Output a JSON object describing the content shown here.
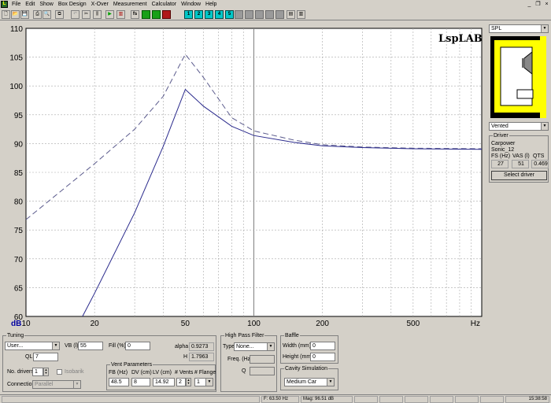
{
  "menu": [
    "File",
    "Edit",
    "Show",
    "Box Design",
    "X-Over",
    "Measurement",
    "Calculator",
    "Window",
    "Help"
  ],
  "window_controls": [
    "_",
    "æ",
    "×"
  ],
  "toolbar": {
    "num_buttons": [
      "1",
      "2",
      "3",
      "4",
      "5"
    ],
    "fs_label": "fs"
  },
  "logo": "LspLAB",
  "chart_data": {
    "type": "line",
    "x_scale": "log",
    "xlim": [
      10,
      1000
    ],
    "ylim": [
      60,
      110
    ],
    "ylabel": "dB",
    "xlabel": "Hz",
    "x_ticks": [
      "10",
      "20",
      "50",
      "100",
      "200",
      "500"
    ],
    "y_ticks": [
      "110",
      "105",
      "100",
      "95",
      "90",
      "85",
      "80",
      "75",
      "70",
      "65",
      "60"
    ],
    "grid": true,
    "series": [
      {
        "style": "dashed",
        "color": "#5a5a8c",
        "x": [
          10,
          20,
          30,
          40,
          50,
          60,
          80,
          100,
          150,
          200,
          300,
          500,
          1000
        ],
        "y": [
          76.8,
          86.5,
          92.5,
          98.2,
          105.5,
          101.5,
          94.5,
          92.2,
          90.6,
          89.8,
          89.4,
          89.2,
          89.1
        ]
      },
      {
        "style": "solid",
        "color": "#2a2a8c",
        "x": [
          17.7,
          20,
          30,
          40,
          50,
          60,
          80,
          100,
          150,
          200,
          300,
          500,
          1000
        ],
        "y": [
          60,
          64,
          78,
          89.5,
          99.4,
          96.5,
          93,
          91.4,
          90.2,
          89.6,
          89.3,
          89.1,
          89.0
        ]
      }
    ]
  },
  "right_panel": {
    "view_select": "SPL",
    "box_type_select": "Vented",
    "driver_group_title": "Driver",
    "driver_brand": "Carpower",
    "driver_model": "Sonic_12",
    "params_headers": [
      "FS (Hz)",
      "VAS (l)",
      "QTS"
    ],
    "params_values": [
      "27",
      "51",
      "0.469"
    ],
    "select_driver_button": "Select driver"
  },
  "tuning": {
    "title": "Tuning",
    "mode_select": "User...",
    "vb_label": "VB (l)",
    "vb_value": "55",
    "fill_label": "Fill (%)",
    "fill_value": "0",
    "ql_label": "QL",
    "ql_value": "7",
    "alpha_label": "alpha",
    "alpha_value": "0.9273",
    "h_label": "H",
    "h_value": "1.7963",
    "no_drivers_label": "No. drivers",
    "no_drivers_value": "1",
    "isobarik_label": "Isobarik",
    "connection_label": "Connection",
    "connection_value": "Parallel"
  },
  "vent": {
    "title": "Vent Parameters",
    "headers": [
      "FB (Hz)",
      "DV (cm)",
      "LV (cm)",
      "# Vents",
      "# Flange"
    ],
    "values": [
      "48.5",
      "8",
      "14.92",
      "2",
      "1"
    ]
  },
  "high_pass": {
    "title": "High Pass Filter",
    "type_label": "Type",
    "type_value": "None...",
    "freq_label": "Freq. (Hz)",
    "q_label": "Q"
  },
  "baffle": {
    "title": "Baffle",
    "width_label": "Width (mm)",
    "width_value": "0",
    "height_label": "Height (mm)",
    "height_value": "0"
  },
  "cavity": {
    "title": "Cavity Simulation",
    "value": "Medium Car"
  },
  "status": {
    "freq": "F: 63.50 Hz",
    "mag": "Mag: 96.51 dB",
    "time": "15:38:58"
  }
}
